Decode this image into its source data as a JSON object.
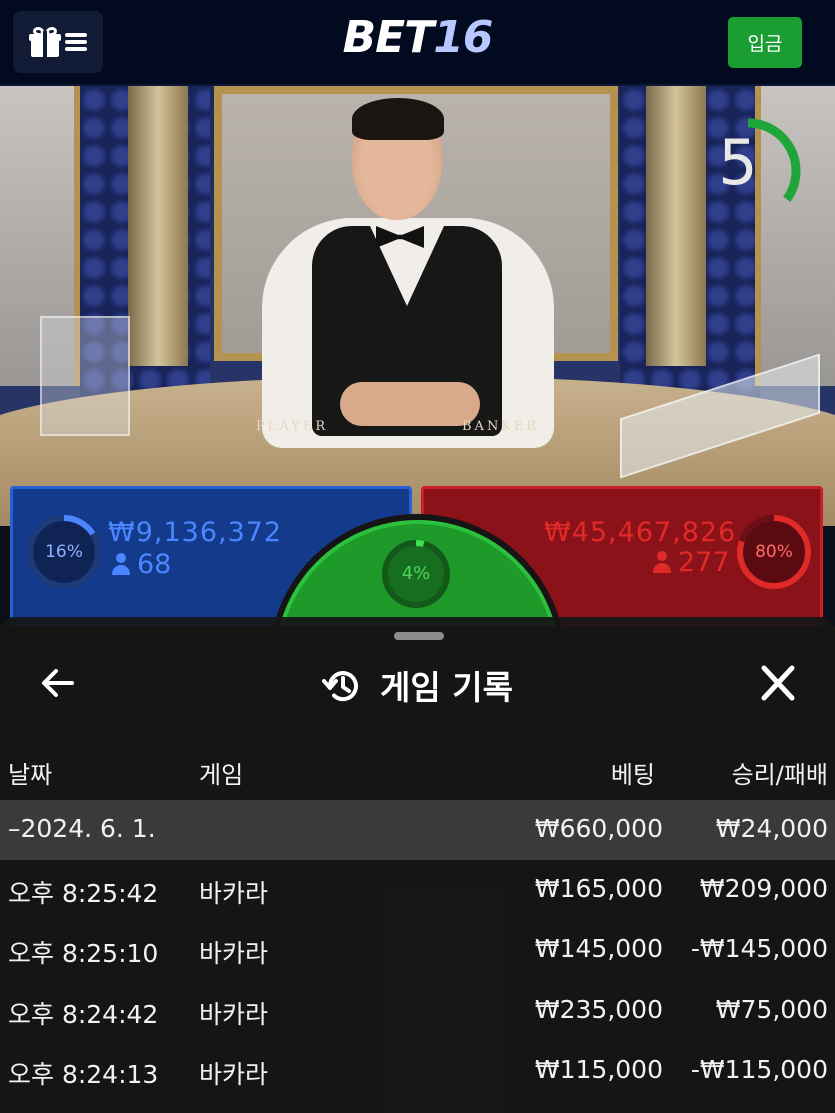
{
  "header": {
    "logo_main": "BET",
    "logo_num": "16",
    "deposit_label": "입금"
  },
  "video": {
    "countdown": "5",
    "countdown_progress": 0.35,
    "table_left_label": "PLAYER",
    "table_right_label": "BANKER"
  },
  "bets": {
    "player": {
      "percent": "16%",
      "percent_value": 0.16,
      "amount": "₩9,136,372",
      "count": "68",
      "color": "#4a7dff"
    },
    "tie": {
      "percent": "4%",
      "percent_value": 0.04,
      "color": "#2cc13c"
    },
    "banker": {
      "percent": "80%",
      "percent_value": 0.8,
      "amount": "₩45,467,826",
      "count": "277",
      "color": "#e02a2a"
    }
  },
  "sheet": {
    "title": "게임 기록",
    "columns": {
      "date": "날짜",
      "game": "게임",
      "bet": "베팅",
      "result": "승리/패배"
    },
    "summary": {
      "date": "–2024. 6. 1.",
      "bet": "₩660,000",
      "result": "₩24,000"
    },
    "rows": [
      {
        "time": "오후 8:25:42",
        "game": "바카라",
        "bet": "₩165,000",
        "result": "₩209,000"
      },
      {
        "time": "오후 8:25:10",
        "game": "바카라",
        "bet": "₩145,000",
        "result": "-₩145,000"
      },
      {
        "time": "오후 8:24:42",
        "game": "바카라",
        "bet": "₩235,000",
        "result": "₩75,000"
      },
      {
        "time": "오후 8:24:13",
        "game": "바카라",
        "bet": "₩115,000",
        "result": "-₩115,000"
      }
    ]
  },
  "icons": {
    "menu": "gift-icon",
    "back": "arrow-left-icon",
    "close": "close-icon",
    "history": "history-icon"
  }
}
